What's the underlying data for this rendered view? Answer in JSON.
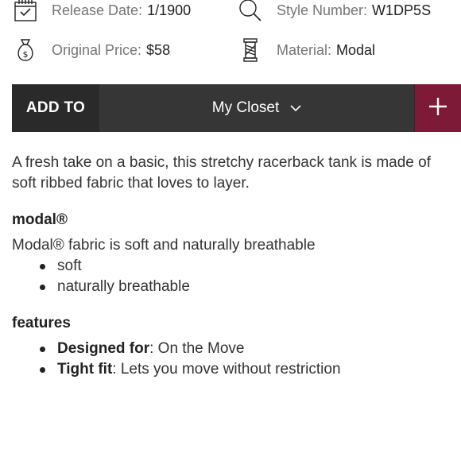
{
  "details": {
    "release_label": "Release Date:",
    "release_value": "1/1900",
    "style_label": "Style Number:",
    "style_value": "W1DP5S",
    "price_label": "Original Price:",
    "price_value": "$58",
    "material_label": "Material:",
    "material_value": "Modal"
  },
  "closet_bar": {
    "add_to_label": "ADD TO",
    "selected_closet": "My Closet",
    "plus_label": "+"
  },
  "description": "A fresh take on a basic, this stretchy racerback tank is made of soft ribbed fabric that loves to layer.",
  "modal_section": {
    "title": "modal®",
    "text": "Modal® fabric is soft and naturally breathable",
    "bullets": [
      "soft",
      "naturally breathable"
    ]
  },
  "features_section": {
    "title": "features",
    "items": [
      {
        "label": "Designed for",
        "value": ": On the Move"
      },
      {
        "label": "Tight fit",
        "value": ": Lets you move without restriction"
      }
    ]
  },
  "colors": {
    "bar_bg": "#363636",
    "add_to_bg": "#2a2a2a",
    "plus_bg": "#7d1a37"
  }
}
